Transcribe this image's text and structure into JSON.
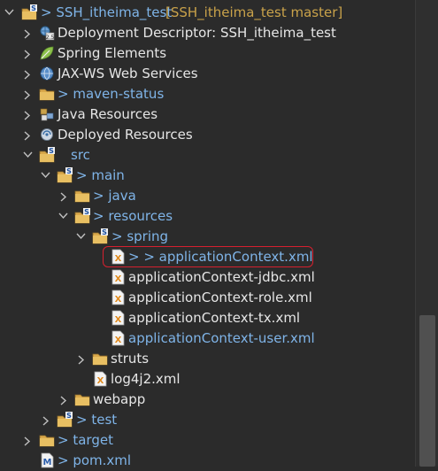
{
  "tree": [
    {
      "label": "> SSH_itheima_test",
      "suffix": " [SSH_itheima_test master]",
      "expanded": true,
      "icon": "project-icon"
    },
    {
      "label": "Deployment Descriptor: SSH_itheima_test",
      "expanded": false,
      "icon": "deployment-descriptor-icon"
    },
    {
      "label": "Spring Elements",
      "expanded": false,
      "icon": "spring-leaf-icon"
    },
    {
      "label": "JAX-WS Web Services",
      "expanded": false,
      "icon": "web-services-icon"
    },
    {
      "label": "> maven-status",
      "expanded": false,
      "icon": "folder-icon"
    },
    {
      "label": "Java Resources",
      "expanded": false,
      "icon": "java-resources-icon"
    },
    {
      "label": "Deployed Resources",
      "expanded": false,
      "icon": "deployed-resources-icon"
    },
    {
      "label": "src",
      "expanded": true,
      "icon": "folder-icon"
    },
    {
      "label": "> main",
      "expanded": true,
      "icon": "folder-icon"
    },
    {
      "label": "> java",
      "expanded": false,
      "icon": "folder-icon"
    },
    {
      "label": "> resources",
      "expanded": true,
      "icon": "folder-icon"
    },
    {
      "label": "> spring",
      "expanded": true,
      "icon": "folder-icon"
    },
    {
      "label": "> > applicationContext.xml",
      "icon": "xml-file-icon"
    },
    {
      "label": "applicationContext-jdbc.xml",
      "icon": "xml-file-icon"
    },
    {
      "label": "applicationContext-role.xml",
      "icon": "xml-file-icon"
    },
    {
      "label": "applicationContext-tx.xml",
      "icon": "xml-file-icon"
    },
    {
      "label": "applicationContext-user.xml",
      "icon": "xml-file-icon"
    },
    {
      "label": "struts",
      "expanded": false,
      "icon": "folder-icon"
    },
    {
      "label": "log4j2.xml",
      "icon": "xml-file-icon"
    },
    {
      "label": "webapp",
      "expanded": false,
      "icon": "folder-icon"
    },
    {
      "label": "> test",
      "expanded": false,
      "icon": "folder-icon"
    },
    {
      "label": "> target",
      "expanded": false,
      "icon": "folder-icon"
    },
    {
      "label": "> pom.xml",
      "icon": "maven-pom-icon"
    }
  ]
}
